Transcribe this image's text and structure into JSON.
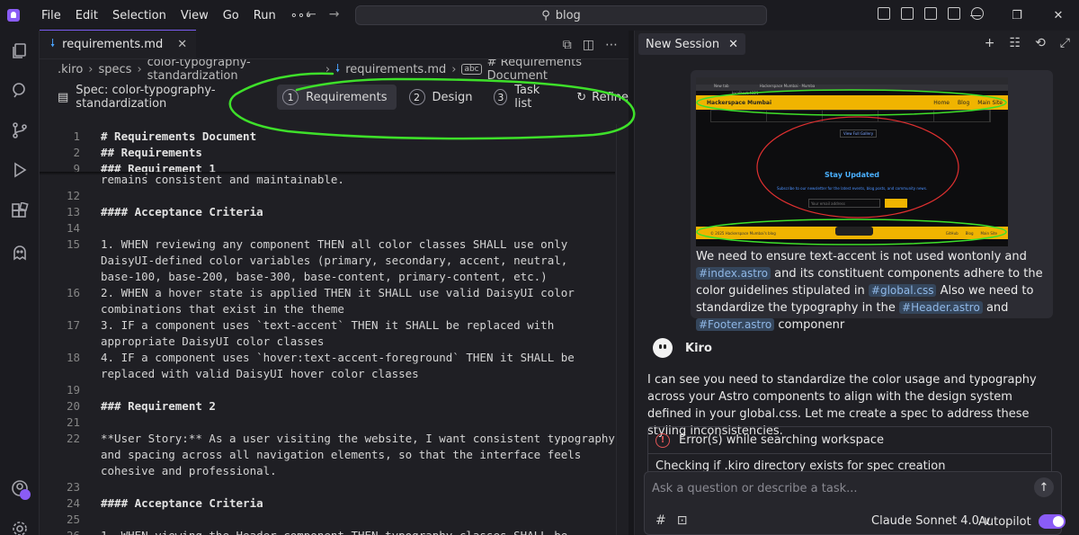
{
  "menu": [
    "File",
    "Edit",
    "Selection",
    "View",
    "Go",
    "Run",
    "∘∘∘"
  ],
  "search_text": "blog",
  "editor": {
    "tab_label": "requirements.md",
    "breadcrumb": [
      ".kiro",
      "specs",
      "color-typography-standardization",
      "requirements.md",
      "# Requirements Document"
    ],
    "spec_title": "Spec: color-typography-standardization",
    "spec_tabs": [
      {
        "num": "1",
        "label": "Requirements"
      },
      {
        "num": "2",
        "label": "Design"
      },
      {
        "num": "3",
        "label": "Task list"
      }
    ],
    "refine_label": "Refine",
    "lines": [
      {
        "n": "1",
        "t": "# Requirements Document"
      },
      {
        "n": "2",
        "t": "## Requirements"
      },
      {
        "n": "9",
        "t": "### Requirement 1"
      },
      {
        "n": "",
        "t": "remains consistent and maintainable."
      },
      {
        "n": "12",
        "t": ""
      },
      {
        "n": "13",
        "t": "#### Acceptance Criteria"
      },
      {
        "n": "14",
        "t": ""
      },
      {
        "n": "15",
        "t": "1. WHEN reviewing any component THEN all color classes SHALL use only"
      },
      {
        "n": "",
        "t": "DaisyUI-defined color variables (primary, secondary, accent, neutral,"
      },
      {
        "n": "",
        "t": "base-100, base-200, base-300, base-content, primary-content, etc.)"
      },
      {
        "n": "16",
        "t": "2. WHEN a hover state is applied THEN it SHALL use valid DaisyUI color"
      },
      {
        "n": "",
        "t": "combinations that exist in the theme"
      },
      {
        "n": "17",
        "t": "3. IF a component uses `text-accent` THEN it SHALL be replaced with"
      },
      {
        "n": "",
        "t": "appropriate DaisyUI color classes"
      },
      {
        "n": "18",
        "t": "4. IF a component uses `hover:text-accent-foreground` THEN it SHALL be"
      },
      {
        "n": "",
        "t": "replaced with valid DaisyUI hover color classes"
      },
      {
        "n": "19",
        "t": ""
      },
      {
        "n": "20",
        "t": "### Requirement 2"
      },
      {
        "n": "21",
        "t": ""
      },
      {
        "n": "22",
        "t": " As a user visiting the website, I want consistent typography",
        "bold": "**User Story:**"
      },
      {
        "n": "",
        "t": "and spacing across all navigation elements, so that the interface feels"
      },
      {
        "n": "",
        "t": "cohesive and professional."
      },
      {
        "n": "23",
        "t": ""
      },
      {
        "n": "24",
        "t": "#### Acceptance Criteria"
      },
      {
        "n": "25",
        "t": ""
      },
      {
        "n": "26",
        "t": "1. WHEN viewing the Header component THEN typography classes SHALL be"
      }
    ]
  },
  "chat": {
    "tab_label": "New Session",
    "screenshot": {
      "tab1": "New tab",
      "tab2": "Hackerspace Mumbai · Mumba",
      "address": "localhost:4321",
      "brand": "Hackerspace Mumbai",
      "nav": [
        "Home",
        "Blog",
        "Main Site"
      ],
      "button": "View Full Gallery",
      "title": "Stay Updated",
      "subtitle": "Subscribe to our newsletter for the latest events, blog posts, and community news.",
      "input_placeholder": "Your email address",
      "footer_left": "© 2025 Hackerspace Mumbai's blog",
      "footer_nav": [
        "GitHub",
        "Blog",
        "Main Site"
      ]
    },
    "user_message": {
      "p1": "We need to ensure text-accent is not used wontonly and ",
      "chip1": "#index.astro",
      "p2": " and its constituent components adhere to the color guidelines stipulated in ",
      "chip2": "#global.css",
      "p3": " Also we need to standardize the typography in the ",
      "chip3": "#Header.astro",
      "p4": " and ",
      "chip4": "#Footer.astro",
      "p5": " componenr"
    },
    "assistant_name": "Kiro",
    "assistant_text": "I can see you need to standardize the color usage and typography across your Astro components to align with the design system defined in your global.css. Let me create a spec to address these styling inconsistencies.",
    "error_label": "Error(s) while searching workspace",
    "checking_text": "Checking if .kiro directory exists for spec creation",
    "input_placeholder": "Ask a question or describe a task...",
    "model_label": "Claude Sonnet 4.0 ∨",
    "autopilot_label": "Autopilot"
  },
  "colors": {
    "accent": "#8a5cf6",
    "annotation": "#3ee02a",
    "annotation_red": "#e03030"
  }
}
